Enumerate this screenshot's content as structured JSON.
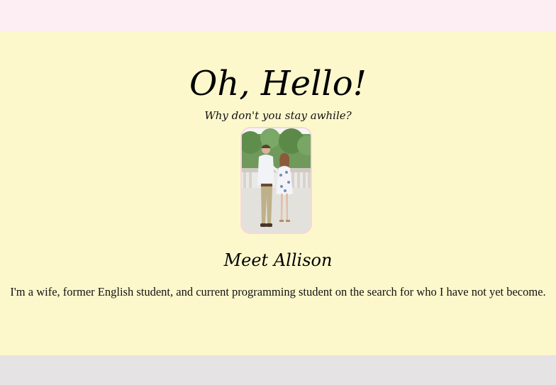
{
  "header": {
    "title": "Oh, Hello!",
    "subtitle": "Why don't you stay awhile?"
  },
  "profile": {
    "photo_alt": "Couple walking together outdoors",
    "name_heading": "Meet Allison",
    "bio": "I'm a wife, former English student, and current programming student on the search for who I have not yet become."
  },
  "colors": {
    "top_bar": "#fdeef4",
    "main_background": "#fdf8cc",
    "bottom_bar": "#e6e3e4",
    "photo_border": "#f7d6dd"
  }
}
